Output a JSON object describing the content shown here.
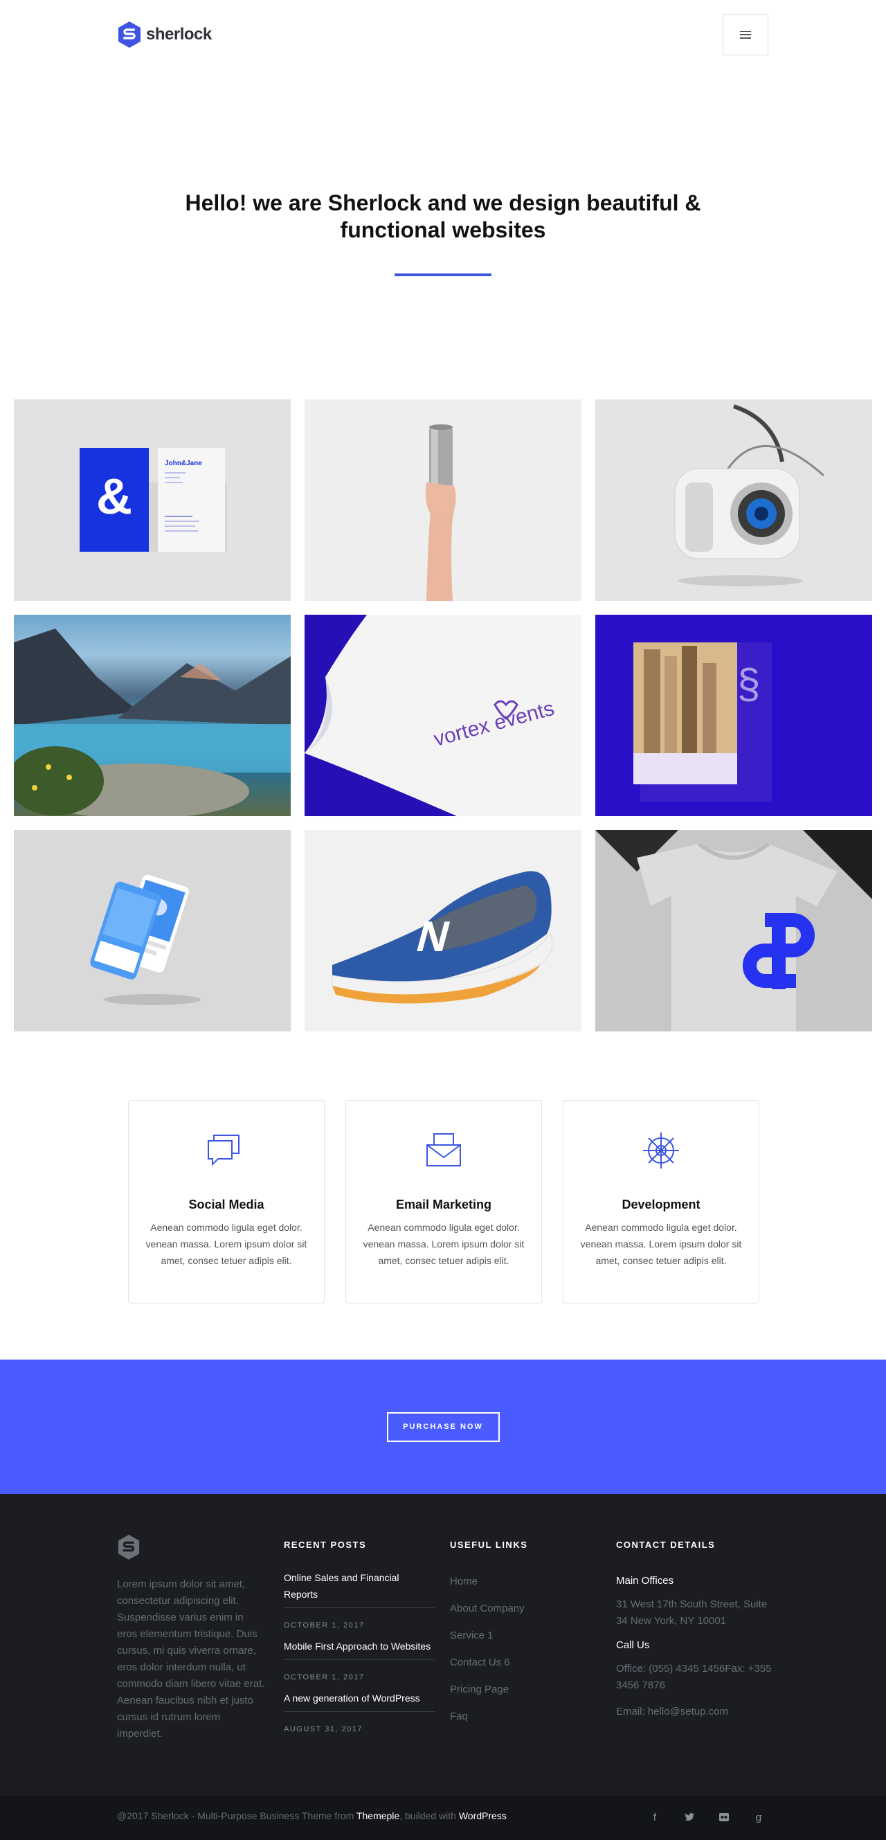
{
  "brand": {
    "name": "sherlock",
    "accent": "#3d55e0",
    "purchase_bg": "#4b5cff",
    "footer_bg": "#1b1d21"
  },
  "header": {
    "menu_icon": "hamburger-icon"
  },
  "hero": {
    "title": "Hello! we are Sherlock and we design beautiful & functional websites"
  },
  "portfolio": {
    "tiles": [
      {
        "subject": "business-cards",
        "text": "John&Jane"
      },
      {
        "subject": "hand-holding-cup"
      },
      {
        "subject": "retro-camera"
      },
      {
        "subject": "mountain-lake"
      },
      {
        "subject": "vortex-events-paper",
        "text": "vortex events"
      },
      {
        "subject": "city-book"
      },
      {
        "subject": "mobile-app-mockup"
      },
      {
        "subject": "blue-sneaker"
      },
      {
        "subject": "tshirt-mockup"
      }
    ]
  },
  "services": [
    {
      "icon": "chat-bubbles-icon",
      "title": "Social Media",
      "text": "Aenean commodo ligula eget dolor. venean massa. Lorem ipsum dolor sit amet, consec tetuer adipis elit."
    },
    {
      "icon": "envelope-icon",
      "title": "Email Marketing",
      "text": "Aenean commodo ligula eget dolor. venean massa. Lorem ipsum dolor sit amet, consec tetuer adipis elit."
    },
    {
      "icon": "ship-wheel-icon",
      "title": "Development",
      "text": "Aenean commodo ligula eget dolor. venean massa. Lorem ipsum dolor sit amet, consec tetuer adipis elit."
    }
  ],
  "purchase": {
    "label": "PURCHASE NOW"
  },
  "footer": {
    "about": "Lorem ipsum dolor sit amet, consectetur adipiscing elit. Suspendisse varius enim in eros elementum tristique. Duis cursus, mi quis viverra ornare, eros dolor interdum nulla, ut commodo diam libero vitae erat. Aenean faucibus nibh et justo cursus id rutrum lorem imperdiet.",
    "recent_posts": {
      "heading": "RECENT POSTS",
      "posts": [
        {
          "title": "Online Sales and Financial Reports",
          "date": "OCTOBER 1, 2017"
        },
        {
          "title": "Mobile First Approach to Websites",
          "date": "OCTOBER 1, 2017"
        },
        {
          "title": "A new generation of WordPress",
          "date": "AUGUST 31, 2017"
        }
      ]
    },
    "useful_links": {
      "heading": "USEFUL LINKS",
      "links": [
        "Home",
        "About Company",
        "Service 1",
        "Contact Us 6",
        "Pricing Page",
        "Faq"
      ]
    },
    "contact": {
      "heading": "CONTACT DETAILS",
      "main_offices_label": "Main Offices",
      "address": "31 West 17th South Street, Suite 34 New York, NY 10001",
      "call_label": "Call Us",
      "phones": "Office: (055) 4345 1456Fax: +355 3456 7876",
      "email": "Email: hello@setup.com"
    },
    "copyright": {
      "prefix": "@2017 Sherlock - Multi-Purpose Business Theme from ",
      "theme_link": "Themeple",
      "middle": ", builded with ",
      "wp_link": "WordPress"
    },
    "socials": [
      {
        "icon": "facebook-icon",
        "glyph": "f"
      },
      {
        "icon": "twitter-icon",
        "glyph": "🐦"
      },
      {
        "icon": "flickr-icon",
        "glyph": "⏺⏺"
      },
      {
        "icon": "google-plus-icon",
        "glyph": "g"
      }
    ]
  }
}
